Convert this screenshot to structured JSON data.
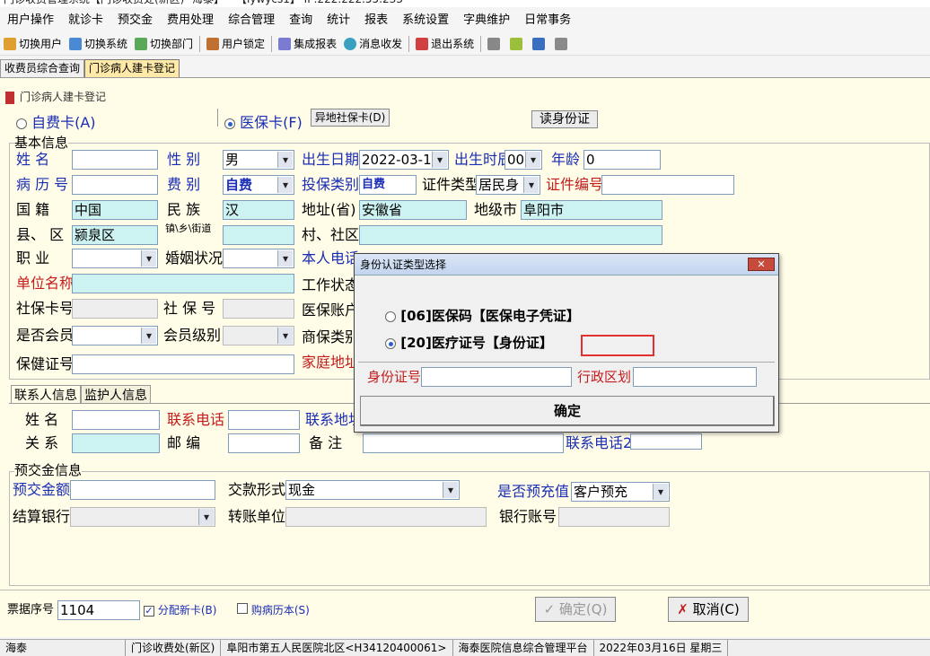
{
  "window": {
    "title": "门诊收费管理系统【门诊收费处(新区)--海泰】---【lywycs1】 IP:222.222.55.233"
  },
  "menu": [
    "用户操作",
    "就诊卡",
    "预交金",
    "费用处理",
    "综合管理",
    "查询",
    "统计",
    "报表",
    "系统设置",
    "字典维护",
    "日常事务"
  ],
  "toolbar": {
    "switch_user": "切换用户",
    "switch_system": "切换系统",
    "switch_dept": "切换部门",
    "lock_user": "用户锁定",
    "report": "集成报表",
    "message": "消息收发",
    "exit": "退出系统"
  },
  "tabs": [
    "收费员综合查询",
    "门诊病人建卡登记"
  ],
  "panel_title": "门诊病人建卡登记",
  "card_type": {
    "self": "自费卡(A)",
    "insurance": "医保卡(F)",
    "remote_button": "异地社保卡(D)",
    "read_id_button": "读身份证"
  },
  "basic": {
    "section": "基本信息",
    "name_label": "姓    名",
    "gender_label": "性    别",
    "gender_value": "男",
    "birth_label": "出生日期",
    "birth_value": "2022-03-16",
    "birth_time_label": "出生时辰",
    "birth_time_value": "00",
    "age_label": "年龄",
    "age_value": "0",
    "record_label": "病 历 号",
    "fee_label": "费    别",
    "fee_value": "自费",
    "ins_type_label": "投保类别",
    "ins_type_value": "自费",
    "id_type_label": "证件类型",
    "id_type_value": "居民身",
    "id_no_label": "证件编号",
    "nation_label": "国    籍",
    "nation_value": "中国",
    "ethnic_label": "民    族",
    "ethnic_value": "汉",
    "province_label": "地址(省)",
    "province_value": "安徽省",
    "city_label": "地级市",
    "city_value": "阜阳市",
    "county_label": "县、  区",
    "county_value": "颍泉区",
    "town_label": "镇\\乡\\街道",
    "village_label": "村、社区",
    "job_label": "职    业",
    "marital_label": "婚姻状况",
    "phone_label": "本人电话",
    "company_label": "单位名称",
    "work_status_label": "工作状态",
    "social_card_label": "社保卡号",
    "social_no_label": "社 保 号",
    "ins_account_label": "医保账户",
    "member_label": "是否会员",
    "member_level_label": "会员级别",
    "commercial_label": "商保类别",
    "health_label": "保健证号",
    "home_label": "家庭地址"
  },
  "contact_tabs": [
    "联系人信息",
    "监护人信息"
  ],
  "contact": {
    "name_label": "姓   名",
    "phone_label": "联系电话",
    "address_label": "联系地址",
    "relation_label": "关   系",
    "postcode_label": "邮    编",
    "note_label": "备    注",
    "phone2_label": "联系电话2"
  },
  "deposit": {
    "section": "预交金信息",
    "amount_label": "预交金额",
    "pay_label": "交款形式",
    "pay_value": "现金",
    "prepay_label": "是否预充值",
    "prepay_value": "客户预充",
    "bank_label": "结算银行",
    "transfer_label": "转账单位",
    "account_label": "银行账号"
  },
  "bottom": {
    "receipt_label": "票据序号",
    "receipt_value": "1104",
    "new_card_label": "分配新卡(B)",
    "buy_record_label": "购病历本(S)",
    "ok_label": "确定(Q)",
    "cancel_label": "取消(C)"
  },
  "dialog": {
    "title": "身份认证类型选择",
    "option1": "[06]医保码【医保电子凭证】",
    "option2": "[20]医疗证号【身份证】",
    "id_label": "身份证号",
    "region_label": "行政区划",
    "ok_label": "确定"
  },
  "status": [
    "海泰",
    "门诊收费处(新区)",
    "阜阳市第五人民医院北区<H34120400061>",
    "海泰医院信息综合管理平台",
    "2022年03月16日 星期三"
  ]
}
